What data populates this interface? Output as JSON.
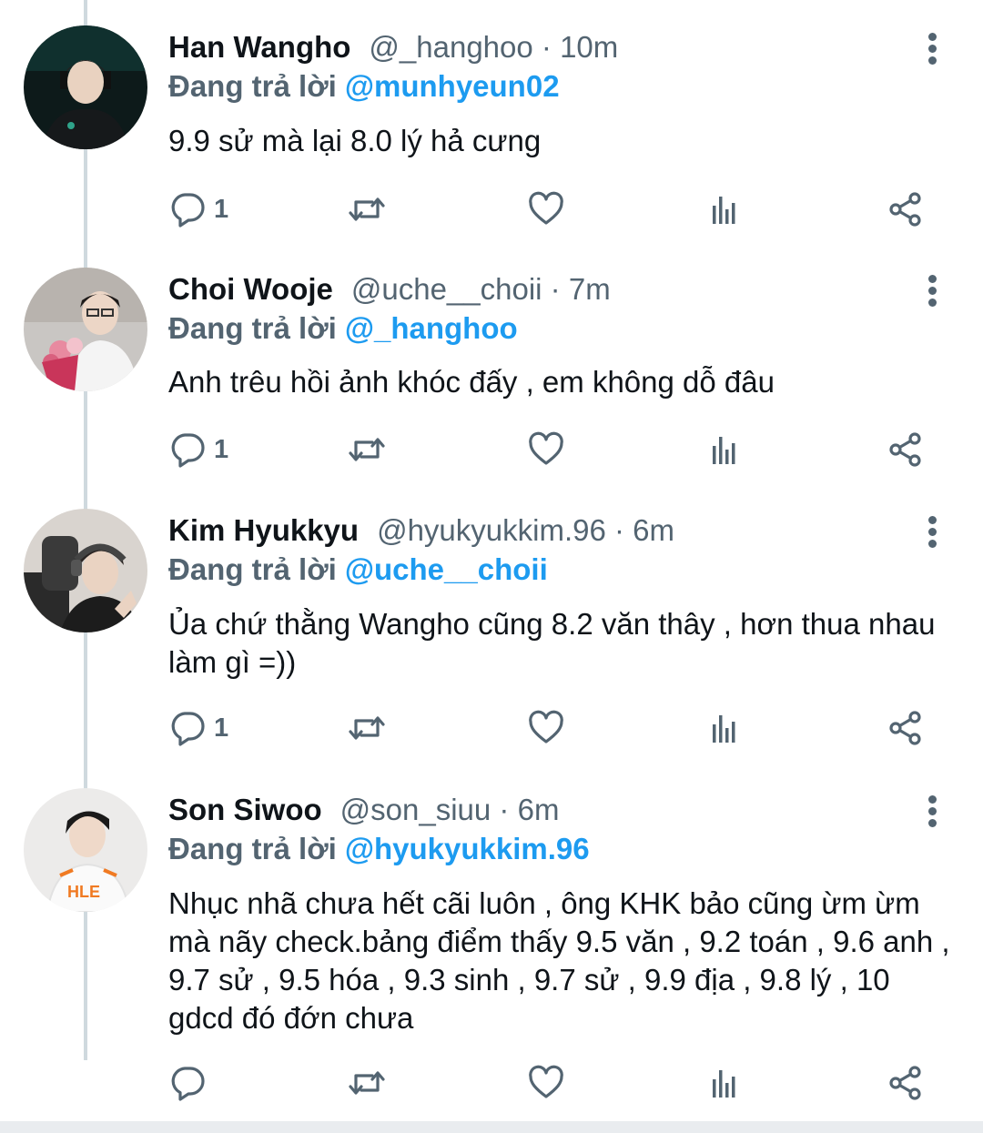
{
  "reply_prefix": "Đang trả lời",
  "tweets": [
    {
      "name": "Han Wangho",
      "meta": "@_hanghoo · 10m",
      "reply_to": "@munhyeun02",
      "text": "9.9 sử mà lại 8.0 lý hả cưng",
      "reply_count": "1"
    },
    {
      "name": "Choi Wooje",
      "meta": "@uche__choii · 7m",
      "reply_to": "@_hanghoo",
      "text": "Anh trêu hồi ảnh khóc đấy , em không dỗ đâu",
      "reply_count": "1"
    },
    {
      "name": "Kim Hyukkyu",
      "meta": "@hyukyukkim.96 · 6m",
      "reply_to": "@uche__choii",
      "text": "Ủa chứ thằng Wangho cũng 8.2 văn thây , hơn thua nhau làm gì =))",
      "reply_count": "1"
    },
    {
      "name": "Son Siwoo",
      "meta": "@son_siuu · 6m",
      "reply_to": "@hyukyukkim.96",
      "text": "Nhục nhã chưa hết cãi luôn , ông KHK bảo cũng ừm ừm mà nãy check.bảng điểm thấy 9.5 văn , 9.2 toán , 9.6 anh , 9.7 sử , 9.5 hóa , 9.3 sinh , 9.7 sử , 9.9 địa , 9.8 lý , 10 gdcd  đó đớn chưa",
      "reply_count": ""
    }
  ],
  "avatar_logo_text": "HLE",
  "icons": [
    "reply-icon",
    "retweet-icon",
    "like-icon",
    "analytics-icon",
    "share-icon",
    "more-icon"
  ],
  "colors": {
    "link": "#1d9bf0",
    "secondary": "#536471",
    "thread_line": "#cfd9de"
  }
}
